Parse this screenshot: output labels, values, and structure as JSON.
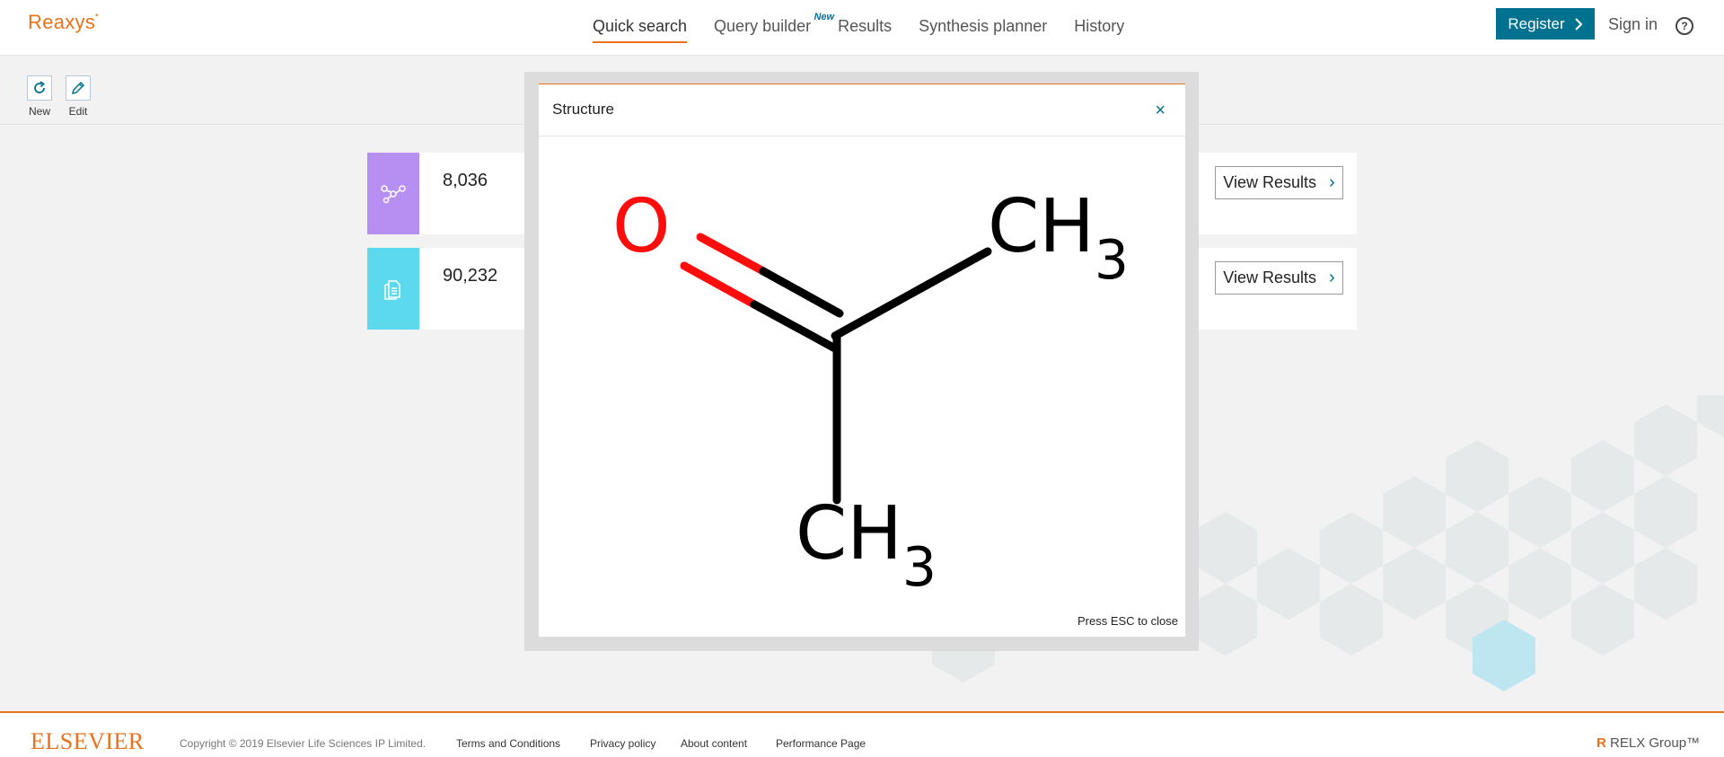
{
  "header": {
    "logo": "Reaxys",
    "nav": [
      {
        "label": "Quick search"
      },
      {
        "label": "Query builder",
        "badge": "New"
      },
      {
        "label": "Results"
      },
      {
        "label": "Synthesis planner"
      },
      {
        "label": "History"
      }
    ],
    "register_label": "Register",
    "signin_label": "Sign in",
    "help_icon": "?"
  },
  "toolbar": {
    "new_label": "New",
    "edit_label": "Edit"
  },
  "results": [
    {
      "icon": "substance-icon",
      "color": "#b78ef2",
      "count": "8,036",
      "button": "View Results"
    },
    {
      "icon": "document-icon",
      "color": "#5cd9ed",
      "count": "90,232",
      "button": "View Results"
    }
  ],
  "modal": {
    "title": "Structure",
    "close": "×",
    "esc_hint": "Press ESC to close",
    "atoms": {
      "oxygen": "O",
      "methyl_top": "CH",
      "methyl_top_sub": "3",
      "methyl_bottom": "CH",
      "methyl_bottom_sub": "3"
    }
  },
  "footer": {
    "brand": "ELSEVIER",
    "copyright": "Copyright © 2019 Elsevier Life Sciences IP Limited.",
    "links": [
      "Terms and Conditions",
      "Privacy policy",
      "About content",
      "Performance Page"
    ],
    "relx": "RELX Group™"
  },
  "colors": {
    "accent": "#e9711c",
    "primary": "#00728f",
    "substance": "#b78ef2",
    "document": "#5cd9ed"
  }
}
